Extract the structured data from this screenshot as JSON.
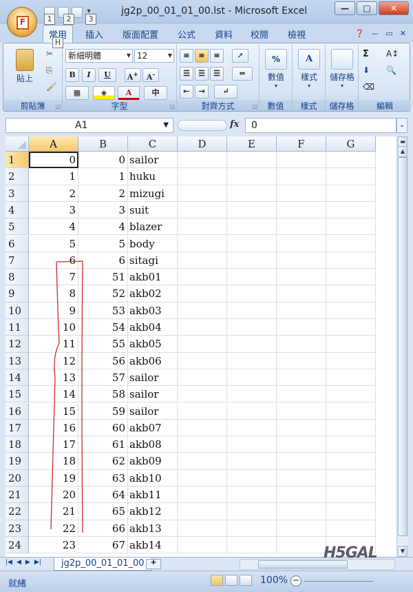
{
  "window": {
    "title": "jg2p_00_01_01_00.lst - Microsoft Excel",
    "controls": [
      "—",
      "□",
      "✕"
    ]
  },
  "quick_access": {
    "keytips": [
      "1",
      "2",
      "3"
    ],
    "home_keytip": "H",
    "logo": "F"
  },
  "tabs": [
    "常用",
    "插入",
    "版面配置",
    "公式",
    "資料",
    "校閱",
    "檢視"
  ],
  "ribbon": {
    "groups": {
      "clipboard": "剪貼簿",
      "font": "字型",
      "alignment": "對齊方式",
      "number": "數值",
      "styles": "樣式",
      "cells": "儲存格",
      "editing": "編輯"
    },
    "paste_label": "貼上",
    "font_name": "新細明體",
    "font_size": "12",
    "bold": "B",
    "italic": "I",
    "underline": "U",
    "number_label": "數值",
    "styles_label": "樣式",
    "cells_label": "儲存格",
    "percent": "%",
    "sigma": "Σ"
  },
  "formula_bar": {
    "name_box": "A1",
    "fx": "fx",
    "formula": "0"
  },
  "grid": {
    "columns": [
      "A",
      "B",
      "C",
      "D",
      "E",
      "F",
      "G"
    ],
    "rows": [
      {
        "n": "1",
        "a": "0",
        "b": "0",
        "c": "sailor"
      },
      {
        "n": "2",
        "a": "1",
        "b": "1",
        "c": "huku"
      },
      {
        "n": "3",
        "a": "2",
        "b": "2",
        "c": "mizugi"
      },
      {
        "n": "4",
        "a": "3",
        "b": "3",
        "c": "suit"
      },
      {
        "n": "5",
        "a": "4",
        "b": "4",
        "c": "blazer"
      },
      {
        "n": "6",
        "a": "5",
        "b": "5",
        "c": "body"
      },
      {
        "n": "7",
        "a": "6",
        "b": "6",
        "c": "sitagi"
      },
      {
        "n": "8",
        "a": "7",
        "b": "51",
        "c": "akb01"
      },
      {
        "n": "9",
        "a": "8",
        "b": "52",
        "c": "akb02"
      },
      {
        "n": "10",
        "a": "9",
        "b": "53",
        "c": "akb03"
      },
      {
        "n": "11",
        "a": "10",
        "b": "54",
        "c": "akb04"
      },
      {
        "n": "12",
        "a": "11",
        "b": "55",
        "c": "akb05"
      },
      {
        "n": "13",
        "a": "12",
        "b": "56",
        "c": "akb06"
      },
      {
        "n": "14",
        "a": "13",
        "b": "57",
        "c": "sailor"
      },
      {
        "n": "15",
        "a": "14",
        "b": "58",
        "c": "sailor"
      },
      {
        "n": "16",
        "a": "15",
        "b": "59",
        "c": "sailor"
      },
      {
        "n": "17",
        "a": "16",
        "b": "60",
        "c": "akb07"
      },
      {
        "n": "18",
        "a": "17",
        "b": "61",
        "c": "akb08"
      },
      {
        "n": "19",
        "a": "18",
        "b": "62",
        "c": "akb09"
      },
      {
        "n": "20",
        "a": "19",
        "b": "63",
        "c": "akb10"
      },
      {
        "n": "21",
        "a": "20",
        "b": "64",
        "c": "akb11"
      },
      {
        "n": "22",
        "a": "21",
        "b": "65",
        "c": "akb12"
      },
      {
        "n": "23",
        "a": "22",
        "b": "66",
        "c": "akb13"
      },
      {
        "n": "24",
        "a": "23",
        "b": "67",
        "c": "akb14"
      }
    ]
  },
  "sheet_tab": "jg2p_00_01_01_00",
  "status": {
    "ready": "就緒",
    "zoom": "100%"
  },
  "watermark": "H5GAL",
  "colors": {
    "accent": "#15428b",
    "annotation": "#cc2b2b"
  }
}
